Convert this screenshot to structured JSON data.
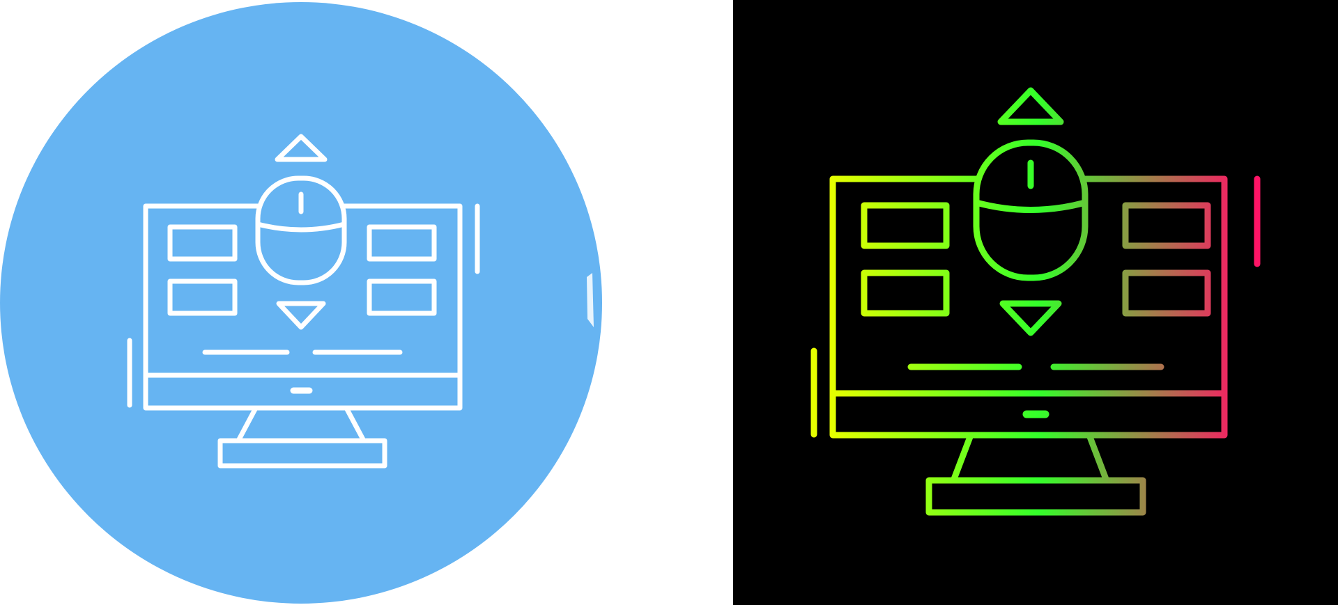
{
  "variants": [
    {
      "style": "line icon on circle",
      "circle_color": "#66b4f2",
      "stroke_color": "#ffffff",
      "background": "#ffffff"
    },
    {
      "style": "gradient line icon",
      "gradient_colors": [
        "#e6ff00",
        "#33ff2a",
        "#ff1466"
      ],
      "background": "#000000"
    }
  ],
  "icon": "computer-mouse-scroll-icon"
}
